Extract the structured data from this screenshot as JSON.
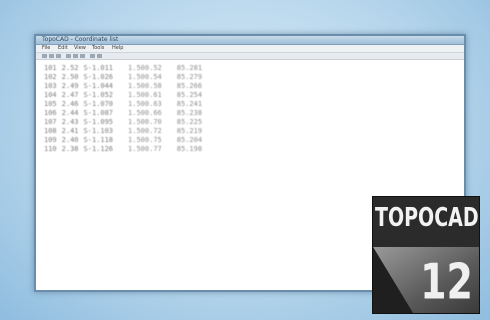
{
  "window": {
    "title": "TopoCAD - Coordinate list"
  },
  "menubar": {
    "items": [
      "File",
      "Edit",
      "View",
      "Tools",
      "Help"
    ]
  },
  "table": {
    "rows": [
      [
        "101",
        "2.52",
        "S-1.011",
        "1.500.52",
        "85.281"
      ],
      [
        "102",
        "2.50",
        "S-1.026",
        "1.500.54",
        "85.279"
      ],
      [
        "103",
        "2.49",
        "S-1.044",
        "1.500.58",
        "85.266"
      ],
      [
        "104",
        "2.47",
        "S-1.052",
        "1.500.61",
        "85.254"
      ],
      [
        "105",
        "2.46",
        "S-1.070",
        "1.500.63",
        "85.241"
      ],
      [
        "106",
        "2.44",
        "S-1.087",
        "1.500.66",
        "85.238"
      ],
      [
        "107",
        "2.43",
        "S-1.095",
        "1.500.70",
        "85.225"
      ],
      [
        "108",
        "2.41",
        "S-1.103",
        "1.500.72",
        "85.219"
      ],
      [
        "109",
        "2.40",
        "S-1.118",
        "1.500.75",
        "85.204"
      ],
      [
        "110",
        "2.38",
        "S-1.126",
        "1.500.77",
        "85.198"
      ]
    ]
  },
  "badge": {
    "title": "TOPOCAD",
    "version": "12"
  },
  "colors": {
    "frame": "#6a8dab",
    "badge_bg": "#2b2b2b",
    "badge_text": "#f2f2f2",
    "backdrop": "#b7d6ec"
  }
}
